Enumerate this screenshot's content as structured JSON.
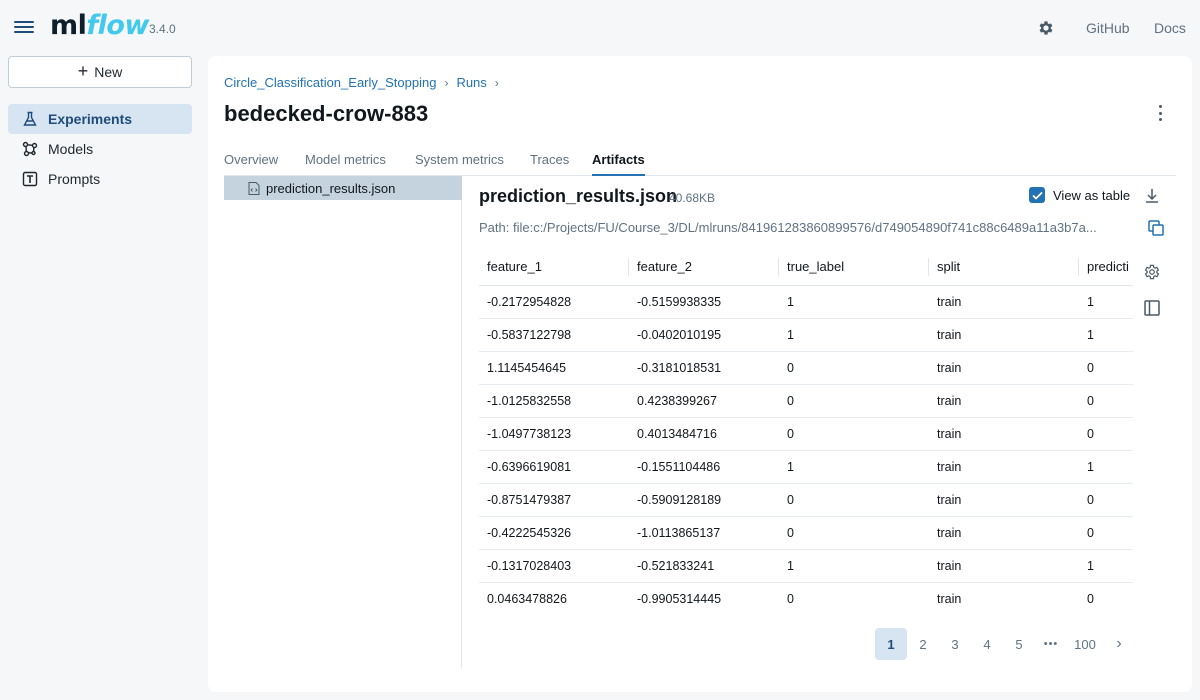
{
  "app": {
    "logo_ml": "ml",
    "logo_flow": "flow",
    "version": "3.4.0",
    "links": {
      "github": "GitHub",
      "docs": "Docs"
    }
  },
  "sidebar": {
    "new_label": "New",
    "items": [
      {
        "label": "Experiments",
        "icon": "flask-icon",
        "active": true
      },
      {
        "label": "Models",
        "icon": "models-icon",
        "active": false
      },
      {
        "label": "Prompts",
        "icon": "prompts-icon",
        "active": false
      }
    ]
  },
  "breadcrumb": {
    "experiment": "Circle_Classification_Early_Stopping",
    "runs": "Runs",
    "sep": "›"
  },
  "run_title": "bedecked-crow-883",
  "tabs": [
    {
      "label": "Overview",
      "active": false
    },
    {
      "label": "Model metrics",
      "active": false
    },
    {
      "label": "System metrics",
      "active": false
    },
    {
      "label": "Traces",
      "active": false
    },
    {
      "label": "Artifacts",
      "active": true
    }
  ],
  "tree": {
    "file": "prediction_results.json"
  },
  "artifact": {
    "name": "prediction_results.json",
    "size": "40.68KB",
    "view_as_table_label": "View as table",
    "view_as_table_checked": true,
    "path": "Path: file:c:/Projects/FU/Course_3/DL/mlruns/841961283860899576/d749054890f741c88c6489a11a3b7a..."
  },
  "table": {
    "columns": [
      "feature_1",
      "feature_2",
      "true_label",
      "split",
      "predicti"
    ],
    "rows": [
      [
        "-0.2172954828",
        "-0.5159938335",
        "1",
        "train",
        "1"
      ],
      [
        "-0.5837122798",
        "-0.0402010195",
        "1",
        "train",
        "1"
      ],
      [
        "1.1145454645",
        "-0.3181018531",
        "0",
        "train",
        "0"
      ],
      [
        "-1.0125832558",
        "0.4238399267",
        "0",
        "train",
        "0"
      ],
      [
        "-1.0497738123",
        "0.4013484716",
        "0",
        "train",
        "0"
      ],
      [
        "-0.6396619081",
        "-0.1551104486",
        "1",
        "train",
        "1"
      ],
      [
        "-0.8751479387",
        "-0.5909128189",
        "0",
        "train",
        "0"
      ],
      [
        "-0.4222545326",
        "-1.0113865137",
        "0",
        "train",
        "0"
      ],
      [
        "-0.1317028403",
        "-0.521833241",
        "1",
        "train",
        "1"
      ],
      [
        "0.0463478826",
        "-0.9905314445",
        "0",
        "train",
        "0"
      ]
    ]
  },
  "pagination": {
    "pages": [
      "1",
      "2",
      "3",
      "4",
      "5"
    ],
    "current": "1",
    "ellipsis": "•••",
    "last": "100",
    "next": "›"
  },
  "colors": {
    "accent": "#2272b4",
    "active_bg": "#d7e5f2",
    "logo_flow": "#43c9ed"
  }
}
